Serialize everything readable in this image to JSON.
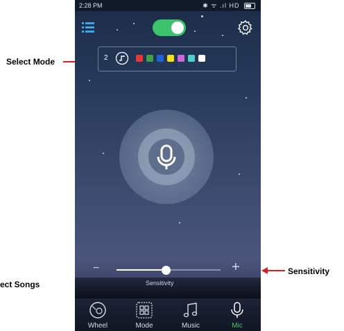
{
  "status_bar": {
    "time": "2:28 PM",
    "indicators": "✱ ᯤ .ıl HD"
  },
  "header": {
    "menu_icon": "menu-icon",
    "power_toggle": true,
    "settings_icon": "gear-icon"
  },
  "mode": {
    "number": "2",
    "icon": "music-note-step-icon",
    "colors": [
      "#e53935",
      "#43a047",
      "#1e63d6",
      "#f5e21a",
      "#c86ad8",
      "#4fd0cc",
      "#ffffff"
    ]
  },
  "mic_button": {
    "icon": "microphone-icon"
  },
  "sensitivity": {
    "label": "Sensitivity",
    "minus": "−",
    "plus": "+",
    "value": 0.47
  },
  "nav": [
    {
      "label": "Wheel",
      "icon": "wheel-icon",
      "active": false
    },
    {
      "label": "Mode",
      "icon": "mode-grid-icon",
      "active": false
    },
    {
      "label": "Music",
      "icon": "music-note-icon",
      "active": false
    },
    {
      "label": "Mic",
      "icon": "microphone-icon",
      "active": true
    }
  ],
  "annotations": {
    "select_mode": "Select Mode",
    "select_songs": "ect Songs",
    "sensitivity": "Sensitivity"
  },
  "colors": {
    "accent_green": "#3cc26a",
    "arrow_red": "#d32020"
  }
}
